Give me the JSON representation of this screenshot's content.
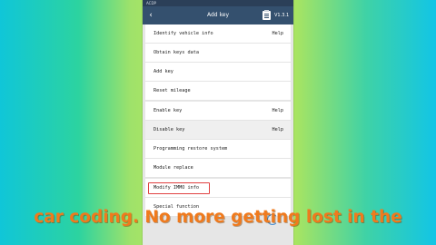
{
  "statusbar": {
    "left": "ACDP",
    "right": ""
  },
  "header": {
    "title": "Add key",
    "version": "V1.3.1",
    "back_icon": "back-arrow-icon",
    "clipboard_icon": "clipboard-icon"
  },
  "items": [
    {
      "label": "Identify vehicle info",
      "help": "Help"
    },
    {
      "label": "Obtain keys data",
      "help": ""
    },
    {
      "label": "Add key",
      "help": ""
    },
    {
      "label": "Reset mileage",
      "help": ""
    },
    {
      "label": "Enable key",
      "help": "Help"
    },
    {
      "label": "Disable key",
      "help": "Help"
    },
    {
      "label": "Programming restore system",
      "help": ""
    },
    {
      "label": "Module replace",
      "help": ""
    },
    {
      "label": "Modify IMMO info",
      "help": ""
    },
    {
      "label": "Special function",
      "help": ""
    }
  ],
  "highlight_color": "#e04040",
  "subtitle": "car coding. No more getting lost in the"
}
